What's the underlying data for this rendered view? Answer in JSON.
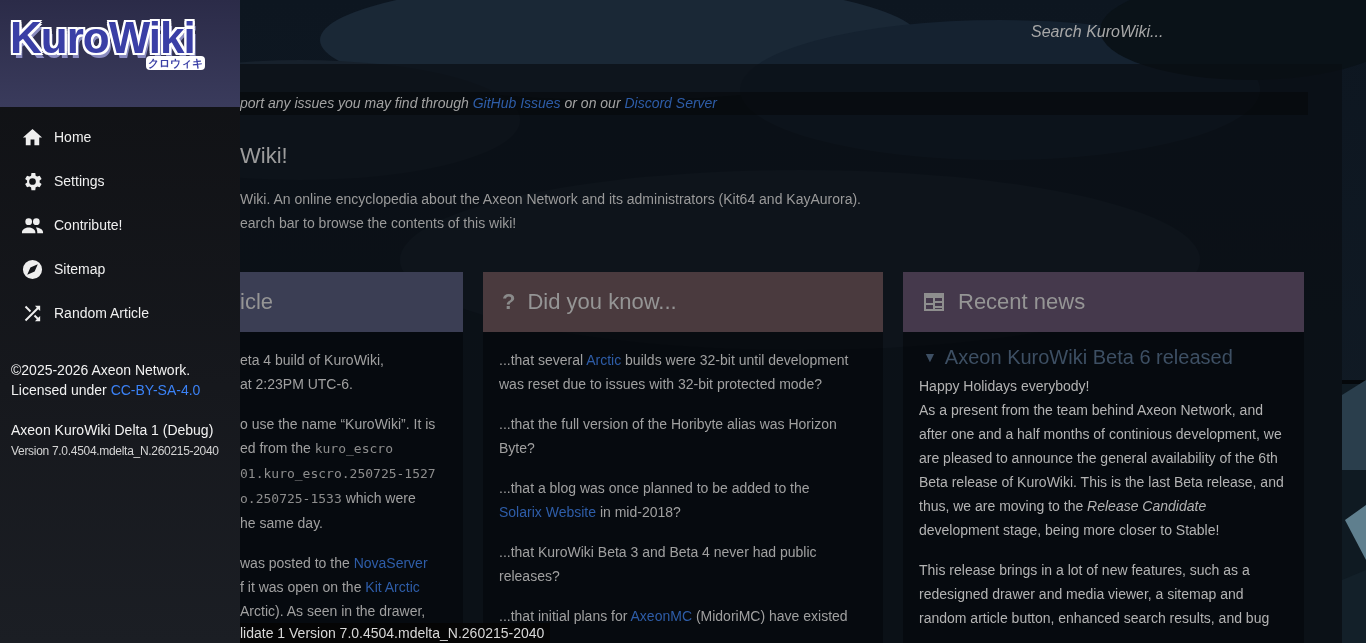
{
  "drawer": {
    "logo": {
      "title": "KuroWiki",
      "subtitle": "クロウィキ"
    },
    "items": [
      {
        "label": "Home"
      },
      {
        "label": "Settings"
      },
      {
        "label": "Contribute!"
      },
      {
        "label": "Sitemap"
      },
      {
        "label": "Random Article"
      }
    ],
    "copyright": "©2025-2026 Axeon Network.",
    "license": {
      "text": "Licensed under",
      "link": "CC-BY-SA-4.0"
    },
    "build": {
      "name": "Axeon KuroWiki Delta 1 (Debug)",
      "version": "Version 7.0.4504.mdelta_N.260215-2040"
    }
  },
  "search": {
    "placeholder": "Search KuroWiki..."
  },
  "notice": [
    {
      "kind": "text",
      "text": "port any issues you may find through "
    },
    {
      "kind": "link",
      "text": "GitHub Issues"
    },
    {
      "kind": "text",
      "text": " or on our "
    },
    {
      "kind": "link",
      "text": "Discord Server"
    }
  ],
  "title": "Wiki!",
  "intro": [
    "Wiki. An online encyclopedia about the Axeon Network and its administrators (Kit64 and KayAurora).",
    "earch bar to browse the contents of this wiki!"
  ],
  "cards": [
    {
      "title": "icle",
      "color": "#3b3e54",
      "paragraphs": [
        {
          "lines": [
            [
              {
                "kind": "text",
                "text": "eta 4 build of KuroWiki,"
              }
            ],
            [
              {
                "kind": "text",
                "text": "at 2:23PM UTC-6."
              }
            ]
          ]
        },
        {
          "lines": [
            [
              {
                "kind": "text",
                "text": "o use the name “KuroWiki”. It is"
              }
            ],
            [
              {
                "kind": "text",
                "text": "ed from the "
              },
              {
                "kind": "code",
                "text": "kuro_escro"
              }
            ],
            [
              {
                "kind": "code",
                "text": "01.kuro_escro.250725-1527"
              }
            ],
            [
              {
                "kind": "code",
                "text": "o.250725-1533"
              },
              {
                "kind": "text",
                "text": " which were"
              }
            ],
            [
              {
                "kind": "text",
                "text": "he same day."
              }
            ]
          ]
        },
        {
          "lines": [
            [
              {
                "kind": "text",
                "text": "was posted to the "
              },
              {
                "kind": "link",
                "text": "NovaServer"
              }
            ],
            [
              {
                "kind": "text",
                "text": "f it was open on the "
              },
              {
                "kind": "link",
                "text": "Kit Arctic"
              }
            ],
            [
              {
                "kind": "text",
                "text": "Arctic). As seen in the drawer,"
              }
            ]
          ]
        }
      ]
    },
    {
      "title": "Did you know...",
      "symbol": "?",
      "color": "#4a3a3e",
      "paragraphs": [
        {
          "segments": [
            {
              "kind": "text",
              "text": "...that several "
            },
            {
              "kind": "link",
              "text": "Arctic"
            },
            {
              "kind": "text",
              "text": " builds were 32-bit until development was reset due to issues with 32-bit protected mode?"
            }
          ]
        },
        {
          "segments": [
            {
              "kind": "text",
              "text": "...that the full version of the Horibyte alias was Horizon Byte?"
            }
          ]
        },
        {
          "segments": [
            {
              "kind": "text",
              "text": "...that a blog was once planned to be added to the "
            },
            {
              "kind": "link",
              "text": "Solarix Website"
            },
            {
              "kind": "text",
              "text": " in mid-2018?"
            }
          ]
        },
        {
          "segments": [
            {
              "kind": "text",
              "text": "...that KuroWiki Beta 3 and Beta 4 never had public releases?"
            }
          ]
        },
        {
          "segments": [
            {
              "kind": "text",
              "text": "...that initial plans for "
            },
            {
              "kind": "link",
              "text": "AxeonMC"
            },
            {
              "kind": "text",
              "text": " (MidoriMC) have existed"
            }
          ]
        }
      ]
    },
    {
      "title": "Recent news",
      "color": "#45394c",
      "heading": {
        "marker": "▼",
        "text": "Axeon KuroWiki Beta 6 released"
      },
      "paragraphs": [
        {
          "segments": [
            {
              "kind": "text",
              "text": "Happy Holidays everybody!"
            },
            {
              "kind": "break"
            },
            {
              "kind": "text",
              "text": "As a present from the team behind Axeon Network, and after one and a half months of continious development, we are pleased to announce the general availability of the 6th Beta release of KuroWiki. This is the last Beta release, and thus, we are moving to the "
            },
            {
              "kind": "italic",
              "text": "Release Candidate"
            },
            {
              "kind": "text",
              "text": " development stage, being more closer to Stable!"
            }
          ]
        },
        {
          "segments": [
            {
              "kind": "text",
              "text": "This release brings in a lot of new features, such as a redesigned drawer and media viewer, a sitemap and random article button, enhanced search results, and bug"
            }
          ]
        }
      ]
    }
  ],
  "overlay": "lidate 1 Version 7.0.4504.mdelta_N.260215-2040"
}
